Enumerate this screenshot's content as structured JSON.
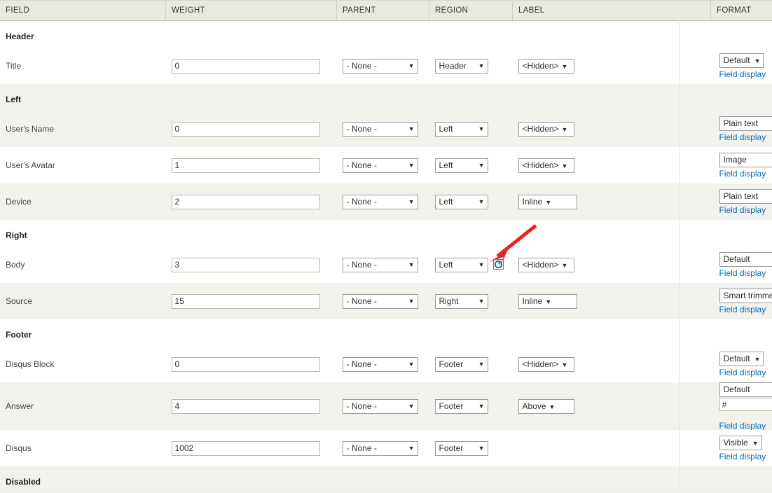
{
  "table": {
    "columns": [
      {
        "key": "field",
        "label": "FIELD"
      },
      {
        "key": "weight",
        "label": "WEIGHT"
      },
      {
        "key": "parent",
        "label": "PARENT"
      },
      {
        "key": "region",
        "label": "REGION"
      },
      {
        "key": "label",
        "label": "LABEL"
      },
      {
        "key": "format",
        "label": "FORMAT"
      }
    ],
    "field_display_link": "Field display",
    "regions": [
      {
        "title": "Header",
        "rows": [
          {
            "field": "Title",
            "weight": "0",
            "parent": "- None -",
            "region": "Header",
            "label": "<Hidden>",
            "format": "Default",
            "format_style": "fmt-default",
            "extra_input": null,
            "throbber": false
          }
        ]
      },
      {
        "title": "Left",
        "rows": [
          {
            "field": "User's Name",
            "weight": "0",
            "parent": "- None -",
            "region": "Left",
            "label": "<Hidden>",
            "format": "Plain text",
            "format_style": "fmt-plain",
            "extra_input": null,
            "throbber": false
          },
          {
            "field": "User's Avatar",
            "weight": "1",
            "parent": "- None -",
            "region": "Left",
            "label": "<Hidden>",
            "format": "Image",
            "format_style": "fmt-image",
            "extra_input": null,
            "throbber": false
          },
          {
            "field": "Device",
            "weight": "2",
            "parent": "- None -",
            "region": "Left",
            "label": "Inline",
            "format": "Plain text",
            "format_style": "fmt-clip",
            "extra_input": null,
            "throbber": false
          }
        ]
      },
      {
        "title": "Right",
        "rows": [
          {
            "field": "Body",
            "weight": "3",
            "parent": "- None -",
            "region": "Left",
            "label": "<Hidden>",
            "format": "Default",
            "format_style": "fmt-clip",
            "extra_input": null,
            "throbber": true
          },
          {
            "field": "Source",
            "weight": "15",
            "parent": "- None -",
            "region": "Right",
            "label": "Inline",
            "format": "Smart trimmed",
            "format_style": "fmt-smart",
            "extra_input": null,
            "throbber": false
          }
        ]
      },
      {
        "title": "Footer",
        "rows": [
          {
            "field": "Disqus Block",
            "weight": "0",
            "parent": "- None -",
            "region": "Footer",
            "label": "<Hidden>",
            "format": "Default",
            "format_style": "fmt-default",
            "extra_input": null,
            "throbber": false
          },
          {
            "field": "Answer",
            "weight": "4",
            "parent": "- None -",
            "region": "Footer",
            "label": "Above",
            "format": "Default",
            "format_style": "fmt-defwide",
            "extra_input": "#",
            "throbber": false
          },
          {
            "field": "Disqus",
            "weight": "1002",
            "parent": "- None -",
            "region": "Footer",
            "label": null,
            "format": "Visible",
            "format_style": "fmt-default",
            "extra_input": null,
            "throbber": false
          }
        ]
      },
      {
        "title": "Disabled",
        "rows": []
      }
    ]
  },
  "annotation": {
    "arrow_color": "#e8251c",
    "points_at": "body-label-select"
  },
  "icons": {
    "throbber": "refresh-icon",
    "caret": "▼"
  }
}
